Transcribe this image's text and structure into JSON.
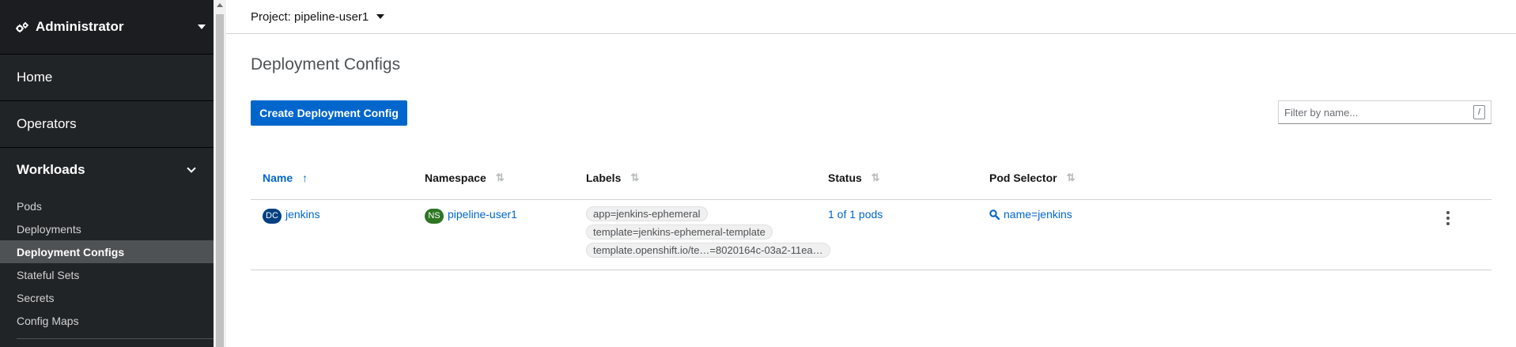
{
  "sidebar": {
    "perspective": "Administrator",
    "sections": [
      {
        "label": "Home"
      },
      {
        "label": "Operators"
      }
    ],
    "workloads": {
      "label": "Workloads",
      "items": [
        {
          "label": "Pods"
        },
        {
          "label": "Deployments"
        },
        {
          "label": "Deployment Configs",
          "active": true
        },
        {
          "label": "Stateful Sets"
        },
        {
          "label": "Secrets"
        },
        {
          "label": "Config Maps"
        }
      ]
    }
  },
  "header": {
    "project_label": "Project: pipeline-user1"
  },
  "page": {
    "title": "Deployment Configs",
    "create_button": "Create Deployment Config",
    "filter_placeholder": "Filter by name...",
    "filter_shortcut": "/"
  },
  "table": {
    "columns": [
      {
        "label": "Name",
        "sorted": "asc"
      },
      {
        "label": "Namespace"
      },
      {
        "label": "Labels"
      },
      {
        "label": "Status"
      },
      {
        "label": "Pod Selector"
      }
    ],
    "rows": [
      {
        "name_badge": "DC",
        "name": "jenkins",
        "namespace_badge": "NS",
        "namespace": "pipeline-user1",
        "labels": [
          "app=jenkins-ephemeral",
          "template=jenkins-ephemeral-template",
          "template.openshift.io/te…=8020164c-03a2-11ea…"
        ],
        "status": "1 of 1 pods",
        "pod_selector": "name=jenkins"
      }
    ]
  },
  "colors": {
    "sidebar_bg": "#212427",
    "primary": "#0066cc",
    "dc_badge": "#004080",
    "ns_badge": "#2d7623",
    "active_nav": "#4f5255"
  }
}
